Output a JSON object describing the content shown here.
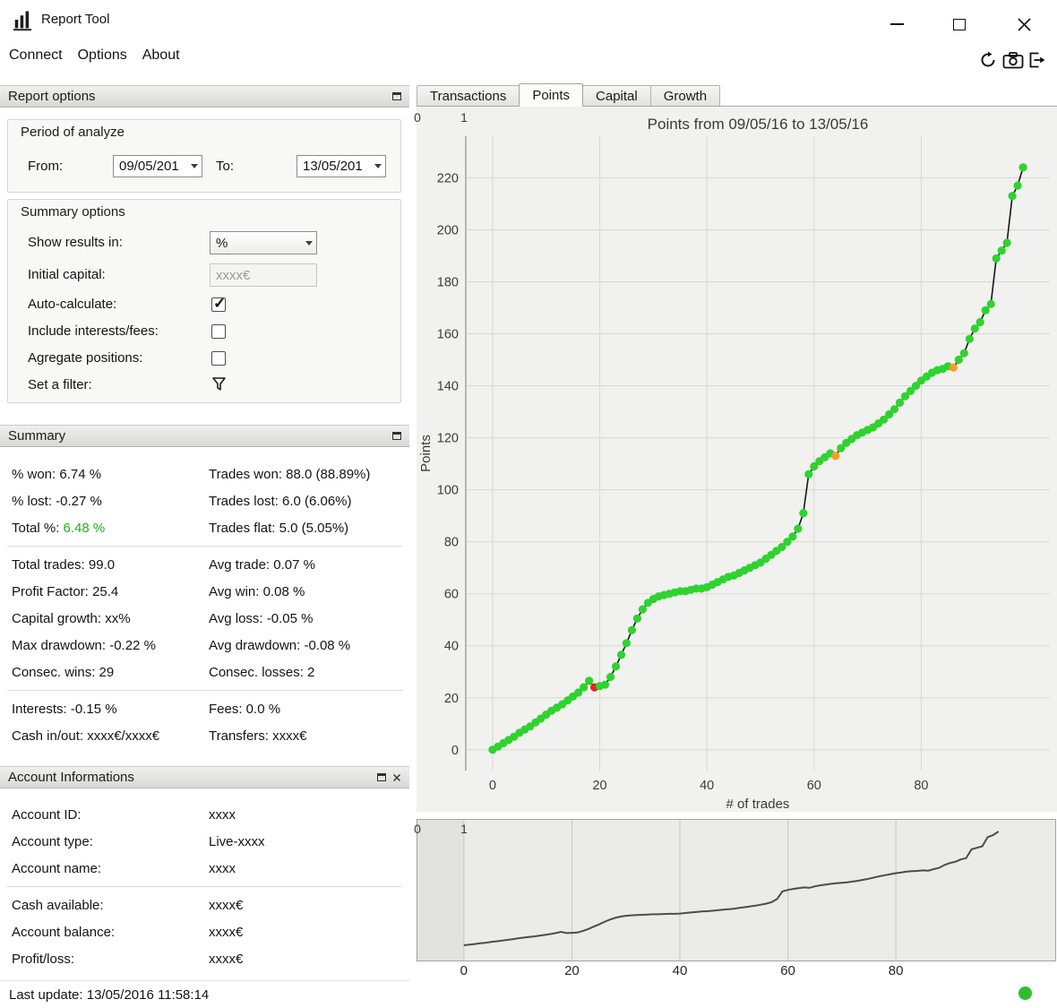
{
  "window": {
    "title": "Report Tool",
    "menu_items": [
      "Connect",
      "Options",
      "About"
    ]
  },
  "icons": {
    "app_icon": "bar-chart",
    "minimize_icon": "dash",
    "maximize_icon": "square-outline",
    "close_icon": "x-cross",
    "refresh_icon": "circular-arrow",
    "camera_icon": "camera-screenshot",
    "export_icon": "export-document",
    "float_panel_icon": "undock-window",
    "close_panel_icon": "x-cross",
    "dropdown_arrow_icon": "triangle-down",
    "checkmark_icon": "check",
    "filter_icon": "funnel",
    "status_ok_icon": "green-circle"
  },
  "left_panel": {
    "report_options": {
      "title": "Report options",
      "period": {
        "title": "Period of analyze",
        "from_label": "From:",
        "from_value": "09/05/201",
        "to_label": "To:",
        "to_value": "13/05/201"
      },
      "options": {
        "title": "Summary options",
        "rows": [
          {
            "label": "Show results in:",
            "value": "%"
          },
          {
            "label": "Initial capital:",
            "placeholder": "xxxx€",
            "disabled": true
          },
          {
            "label": "Auto-calculate:",
            "checked": true
          },
          {
            "label": "Include interests/fees:",
            "checked": false
          },
          {
            "label": "Agregate positions:",
            "checked": false
          },
          {
            "label": "Set a filter:"
          }
        ]
      }
    },
    "summary": {
      "title": "Summary",
      "b1": [
        {
          "l": "% won: 6.74 %",
          "r": "Trades won: 88.0 (88.89%)"
        },
        {
          "l": "% lost: -0.27 %",
          "r": "Trades lost: 6.0 (6.06%)"
        },
        {
          "l_label": "Total %: ",
          "l_value": "6.48 %",
          "l_value_color": "#1fb024",
          "r": "Trades flat: 5.0 (5.05%)"
        }
      ],
      "b2": [
        {
          "l": "Total trades: 99.0",
          "r": "Avg trade: 0.07 %"
        },
        {
          "l": "Profit Factor: 25.4",
          "r": "Avg win: 0.08 %"
        },
        {
          "l": "Capital growth: xx%",
          "r": "Avg loss: -0.05 %"
        },
        {
          "l": "Max drawdown: -0.22 %",
          "r": "Avg drawdown: -0.08 %"
        },
        {
          "l": "Consec. wins: 29",
          "r": "Consec. losses: 2"
        }
      ],
      "b3": [
        {
          "l": "Interests: -0.15 %",
          "r": "Fees: 0.0 %"
        },
        {
          "l": "Cash in/out: xxxx€/xxxx€",
          "r": "Transfers: xxxx€"
        }
      ]
    },
    "account": {
      "title": "Account Informations",
      "b1": [
        {
          "label": "Account ID:",
          "value": "xxxx"
        },
        {
          "label": "Account type:",
          "value": "Live-xxxx"
        },
        {
          "label": "Account name:",
          "value": "xxxx"
        }
      ],
      "b2": [
        {
          "label": "Cash available:",
          "value": "xxxx€"
        },
        {
          "label": "Account balance:",
          "value": "xxxx€"
        },
        {
          "label": "Profit/loss:",
          "value": "xxxx€"
        }
      ]
    },
    "status_bar": {
      "text": "Last update: 13/05/2016 11:58:14"
    }
  },
  "tabs": {
    "items": [
      "Transactions",
      "Points",
      "Capital",
      "Growth"
    ],
    "active": "Points"
  },
  "status_indicator": {
    "color": "#2fbd2f"
  },
  "chart_data": [
    {
      "type": "line+scatter",
      "title": "Points from 09/05/16 to 13/05/16",
      "xlabel": "# of trades",
      "ylabel": "Points",
      "x": {
        "start": 0,
        "step": 1,
        "count": 100,
        "meaning": "trade index"
      },
      "values": [
        0,
        1.2,
        2.5,
        3.8,
        5,
        6.5,
        7.8,
        9,
        10.5,
        12,
        13.5,
        15,
        16.2,
        17.5,
        19,
        20.5,
        22,
        24,
        26.5,
        24,
        24.5,
        25,
        28,
        32,
        36.5,
        41,
        46,
        50.5,
        54,
        56.5,
        58,
        59,
        59.5,
        60,
        60.5,
        61,
        61,
        61.5,
        62,
        62,
        62.5,
        63.5,
        64.5,
        65.5,
        66.5,
        67,
        68,
        69,
        70,
        71,
        72,
        73.5,
        75,
        76.5,
        78,
        80,
        82,
        85,
        91,
        106,
        109,
        111,
        112.5,
        114,
        113,
        116,
        118,
        119.5,
        121,
        122,
        123,
        124,
        125.5,
        127,
        129,
        131,
        133.5,
        136,
        138,
        140,
        142,
        143.5,
        145,
        146,
        146.5,
        147.5,
        147,
        150,
        152.5,
        158,
        162,
        164.5,
        169,
        171.5,
        189,
        192,
        195,
        213,
        217,
        224
      ],
      "xticks": [
        0,
        20,
        40,
        60,
        80
      ],
      "yticks": [
        0,
        20,
        40,
        60,
        80,
        100,
        120,
        140,
        160,
        180,
        200,
        220
      ],
      "xlim": [
        -5,
        104
      ],
      "ylim": [
        -8,
        236
      ],
      "grid": true,
      "legend": "none",
      "line_color": "#161616",
      "point_color": "#2fd32f",
      "special_points": {
        "19": "#e0281c",
        "64": "#ff9b2a",
        "86": "#ff9b2a"
      },
      "corner_labels": [
        "0",
        "1"
      ]
    },
    {
      "type": "line",
      "role": "overview-navigator",
      "series_ref": "same values as chart 0",
      "xticks": [
        0,
        20,
        40,
        60,
        80
      ],
      "xlim": [
        -8.6,
        109.5
      ],
      "ylim": [
        -30,
        247
      ],
      "grid": true,
      "line_color": "#4c4c4c",
      "corner_labels": [
        "0",
        "1"
      ]
    }
  ]
}
